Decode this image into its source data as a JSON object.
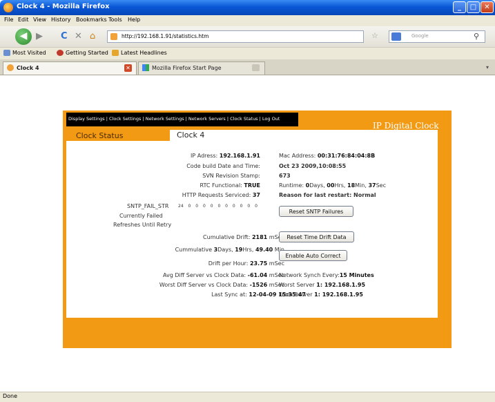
{
  "window": {
    "title": "Clock 4 - Mozilla Firefox",
    "controls": {
      "minimize": "_",
      "maximize": "□",
      "close": "✕"
    }
  },
  "menu": [
    "File",
    "Edit",
    "View",
    "History",
    "Bookmarks",
    "Tools",
    "Help"
  ],
  "nav": {
    "back": "◀",
    "forward": "▶",
    "reload": "C",
    "stop": "✕",
    "home": "⌂",
    "url": "http://192.168.1.91/statistics.htm",
    "search_placeholder": "Google",
    "star": "☆"
  },
  "bookmarks": [
    "Most Visited",
    "Getting Started",
    "Latest Headlines"
  ],
  "tabs": [
    "Clock 4",
    "Mozilla Firefox Start Page"
  ],
  "page": {
    "topnav": "Display Settings | Clock Settings | Network Settings | Network Servers | Clock Status | Log Out",
    "brand": "IP Digital Clock",
    "tab_inactive": "Clock Status",
    "tab_active": "Clock 4",
    "left_rows": [
      {
        "label": "IP Adress:",
        "value": "192.168.1.91",
        "suffix": ""
      },
      {
        "label": "Code build Date and Time:",
        "value": "",
        "suffix": ""
      },
      {
        "label": "SVN Revision Stamp:",
        "value": "",
        "suffix": ""
      },
      {
        "label": "RTC Functional:",
        "value": "TRUE",
        "suffix": ""
      },
      {
        "label": "HTTP Requests Serviced:",
        "value": "37",
        "suffix": ""
      }
    ],
    "sntp_label": "SNTP_FAIL_STR",
    "sntp_values": "24 0 0 0 0 0 0 0 0 0 0",
    "currently_failed": "Currently Failed",
    "refreshes": "Refreshes Until Retry",
    "cum_drift": {
      "label": "Cumulative Drift:",
      "value": "2181",
      "suffix": "mSec"
    },
    "cum_time": {
      "label": "Cummulative",
      "d": "3",
      "d_unit": "Days,",
      "h": "19",
      "h_unit": "Hrs,",
      "m": "49.40",
      "m_unit": "Min"
    },
    "drift_hour": {
      "label": "Drift per Hour:",
      "value": "23.75",
      "suffix": "mSec"
    },
    "avg_diff": {
      "label": "Avg Diff Server vs Clock Data:",
      "value": "-61.04",
      "suffix": "mSec"
    },
    "worst_diff": {
      "label": "Worst Diff Server vs Clock Data:",
      "value": "-1526",
      "suffix": "mSec"
    },
    "last_sync": {
      "label": "Last Sync at:",
      "value": "12-04-09 15:35:47"
    },
    "mac": {
      "label": "Mac Address:",
      "value": "00:31:76:84:04:8B"
    },
    "build_date": "Oct 23 2009,10:08:55",
    "svn": "673",
    "runtime": {
      "label": "Runtime:",
      "d": "0",
      "d_unit": "Days,",
      "h": "00",
      "h_unit": "Hrs,",
      "m": "18",
      "m_unit": "Min,",
      "s": "37",
      "s_unit": "Sec"
    },
    "restart": "Reason for last restart: Normal",
    "btn_reset_sntp": "Reset SNTP Failures",
    "btn_reset_drift": "Reset Time Drift Data",
    "btn_auto_correct": "Enable Auto Correct",
    "synch": {
      "label": "Network Synch Every:",
      "value": "15 Minutes"
    },
    "worst_server": {
      "label": "Worst Server",
      "value": "1: 192.168.1.95"
    },
    "from_server": {
      "label": "From Server",
      "value": "1: 192.168.1.95"
    }
  },
  "status": "Done",
  "colors": {
    "page_orange": "#f39a14",
    "titlebar_blue": "#0a57d6"
  }
}
